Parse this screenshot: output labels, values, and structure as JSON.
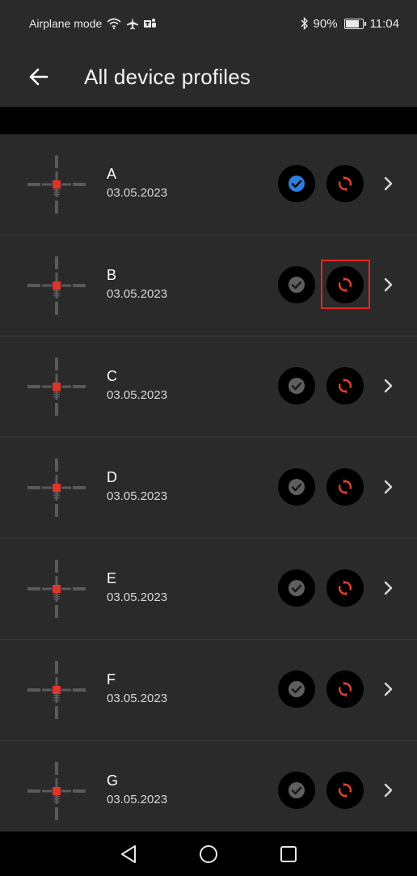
{
  "status_bar": {
    "left_text": "Airplane mode",
    "battery": "90%",
    "battery_level": 0.9,
    "time": "11:04",
    "icons": [
      "wifi-icon",
      "airplane-icon",
      "teams-icon",
      "bluetooth-icon",
      "battery-icon"
    ]
  },
  "app_bar": {
    "back_icon": "arrow-left-icon",
    "title": "All device profiles"
  },
  "profiles": [
    {
      "name": "A",
      "date": "03.05.2023",
      "active": true
    },
    {
      "name": "B",
      "date": "03.05.2023",
      "active": false
    },
    {
      "name": "C",
      "date": "03.05.2023",
      "active": false
    },
    {
      "name": "D",
      "date": "03.05.2023",
      "active": false
    },
    {
      "name": "E",
      "date": "03.05.2023",
      "active": false
    },
    {
      "name": "F",
      "date": "03.05.2023",
      "active": false
    },
    {
      "name": "G",
      "date": "03.05.2023",
      "active": false
    }
  ],
  "highlighted_profile": "B",
  "colors": {
    "background": "#2a2a2a",
    "active_check": "#2f7de1",
    "inactive_check": "#5f5f5f",
    "sync_accent": "#e5432d",
    "highlight": "#e32525",
    "crosshair_center": "#e0342a"
  },
  "nav_bar": {
    "icons": [
      "back-triangle-icon",
      "home-circle-icon",
      "recents-square-icon"
    ]
  }
}
